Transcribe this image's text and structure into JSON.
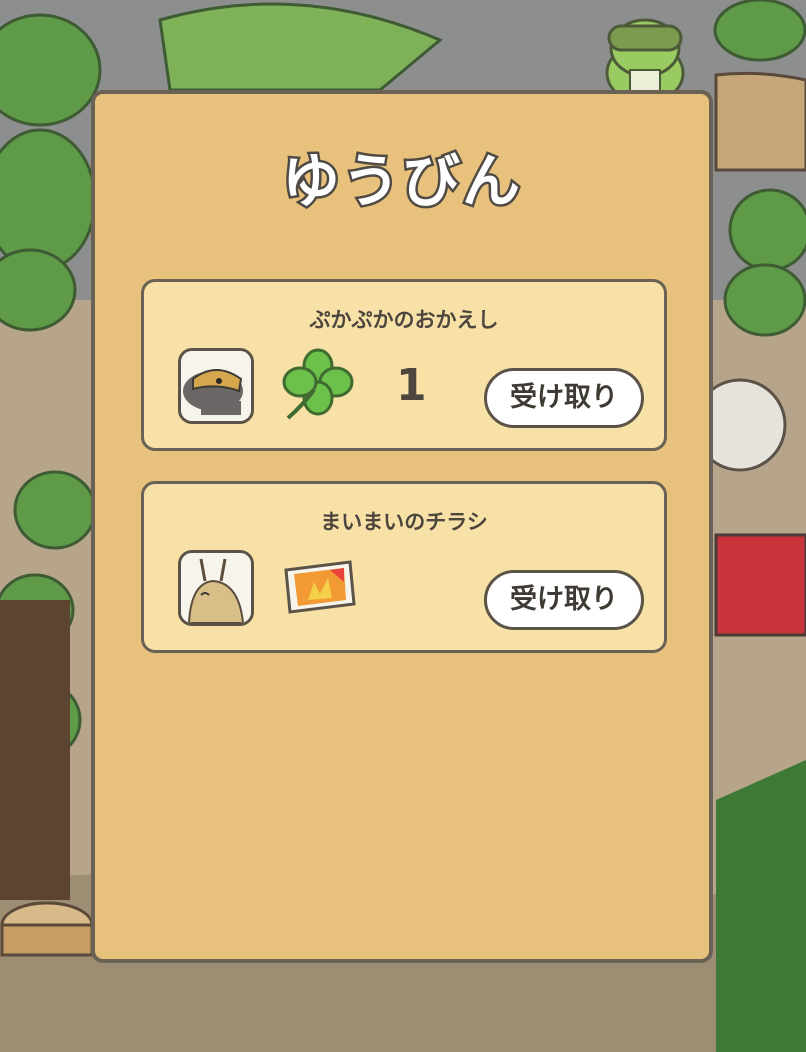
{
  "window": {
    "title": "ゆうびん"
  },
  "mails": [
    {
      "sender": "ぷかぷかのおかえし",
      "item_icon": "four-leaf-clover-icon",
      "quantity": "1",
      "button_label": "受け取り"
    },
    {
      "sender": "まいまいのチラシ",
      "item_icon": "flyer-icon",
      "quantity": "",
      "button_label": "受け取り"
    }
  ],
  "colors": {
    "panel": "#e8c27c",
    "card": "#f8e1a6",
    "border": "#6a6254",
    "clover": "#6cc14a"
  }
}
